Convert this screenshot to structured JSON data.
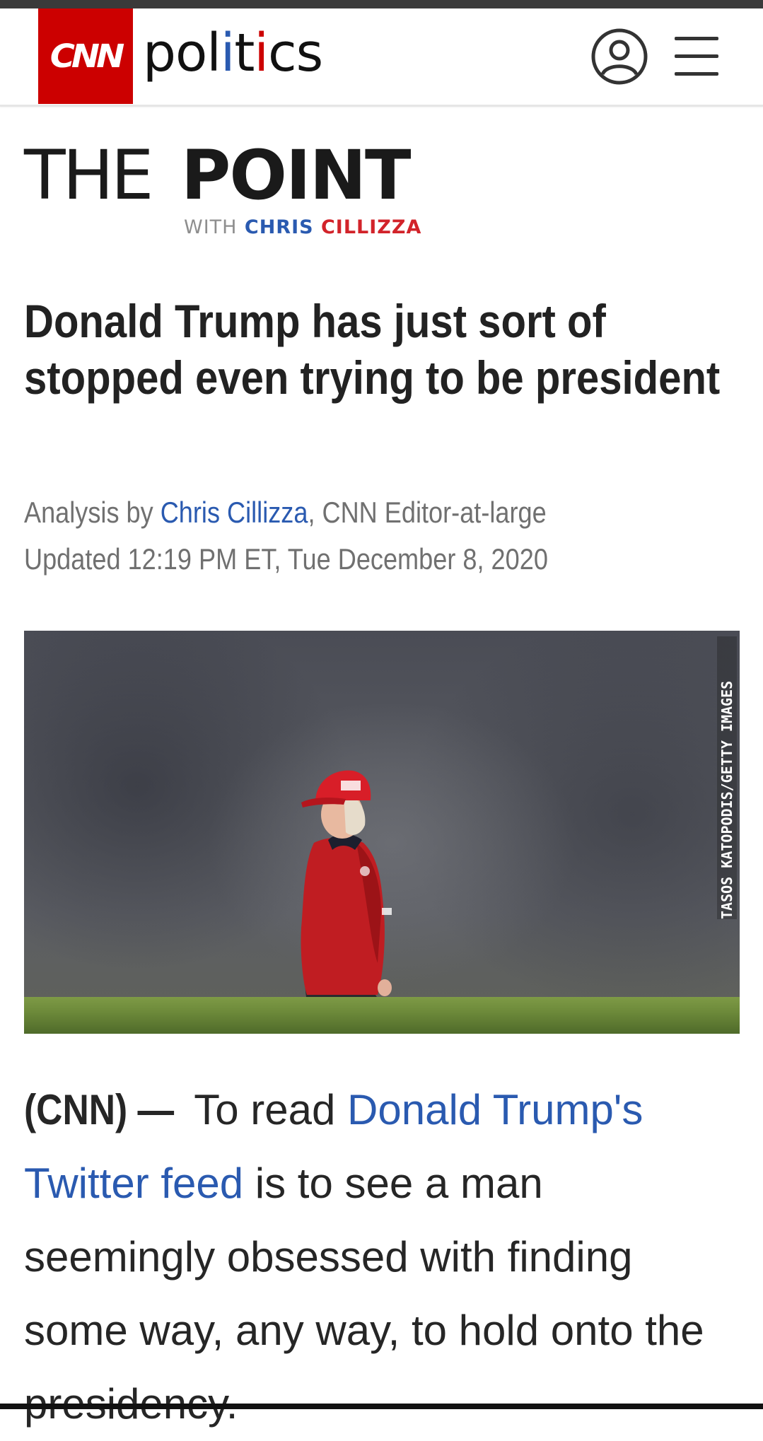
{
  "header": {
    "logo_text": "CNN",
    "section": [
      "pol",
      "i",
      "t",
      "i",
      "cs"
    ],
    "account_label": "Account",
    "menu_label": "Menu"
  },
  "column": {
    "the": "THE",
    "point": "POINT",
    "with": "WITH",
    "author_first": "CHRIS",
    "author_last": "CILLIZZA"
  },
  "article": {
    "headline": "Donald Trump has just sort of stopped even trying to be president",
    "byline_prefix": "Analysis by ",
    "author": "Chris Cillizza",
    "byline_suffix": ", CNN Editor-at-large",
    "updated": "Updated 12:19 PM ET, Tue December 8, 2020",
    "photo_credit": "TASOS KATOPODIS/GETTY IMAGES",
    "dateline": "(CNN) —",
    "lead_intro": " To read ",
    "lead_link": "Donald Trump's Twitter feed",
    "lead_rest": " is to see a man seemingly obsessed with finding some way, any way, to hold onto the presidency."
  },
  "colors": {
    "cnn_red": "#cc0000",
    "link_blue": "#2a5ab0",
    "cillizza_red": "#d2232a"
  }
}
